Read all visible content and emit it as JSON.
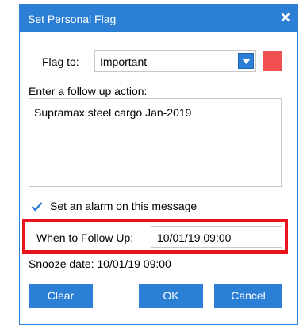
{
  "dialog": {
    "title": "Set Personal Flag",
    "close_glyph": "✕"
  },
  "flag": {
    "label": "Flag to:",
    "selected": "Important",
    "color": "#f05050"
  },
  "follow_up_action": {
    "label": "Enter a follow up action:",
    "value": "Supramax steel cargo Jan-2019"
  },
  "alarm": {
    "checked": true,
    "label": "Set an alarm on this message"
  },
  "when_to_follow_up": {
    "label": "When to Follow Up:",
    "value": "10/01/19 09:00",
    "highlight_color": "#e8141c"
  },
  "snooze": {
    "text": "Snooze date: 10/01/19 09:00"
  },
  "buttons": {
    "clear": "Clear",
    "ok": "OK",
    "cancel": "Cancel"
  },
  "colors": {
    "accent": "#2b7fd4"
  }
}
